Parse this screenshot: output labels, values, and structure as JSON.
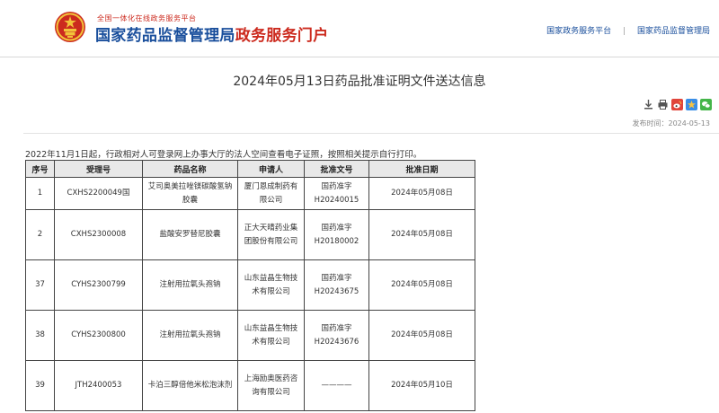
{
  "header": {
    "slogan": "全国一体化在线政务服务平台",
    "title_main": "国家药品监督管理局",
    "title_accent": "政务服务门户",
    "links": [
      {
        "label": "国家政务服务平台"
      },
      {
        "label": "国家药品监督管理局"
      }
    ],
    "link_separator": "|"
  },
  "colors": {
    "brand_blue": "#1a4f9c",
    "brand_red": "#cc2a1e",
    "emblem_gold": "#f2c23a"
  },
  "article": {
    "title": "2024年05月13日药品批准证明文件送达信息",
    "tools": [
      {
        "icon": "download-icon"
      },
      {
        "icon": "print-icon"
      },
      {
        "icon": "weibo-share-icon"
      },
      {
        "icon": "favorite-star-icon"
      },
      {
        "icon": "wechat-share-icon"
      }
    ],
    "published": "发布时间：2024-05-13",
    "notice": "2022年11月1日起，行政相对人可登录网上办事大厅的法人空间查看电子证照，按照相关提示自行打印。"
  },
  "table": {
    "headers": [
      "序号",
      "受理号",
      "药品名称",
      "申请人",
      "批准文号",
      "批准日期"
    ],
    "rows": [
      {
        "no": "1",
        "accept_no": "CXHS2200049国",
        "drug": "艾司奥美拉唑镁碳酸氢钠胶囊",
        "applicant": "厦门恩成制药有限公司",
        "approval_no": "国药准字H20240015",
        "date": "2024年05月08日"
      },
      {
        "no": "2",
        "accept_no": "CXHS2300008",
        "drug": "盐酸安罗替尼胶囊",
        "applicant": "正大天晴药业集团股份有限公司",
        "approval_no": "国药准字H20180002",
        "date": "2024年05月08日"
      },
      {
        "no": "37",
        "accept_no": "CYHS2300799",
        "drug": "注射用拉氧头孢钠",
        "applicant": "山东益晶生物技术有限公司",
        "approval_no": "国药准字H20243675",
        "date": "2024年05月08日"
      },
      {
        "no": "38",
        "accept_no": "CYHS2300800",
        "drug": "注射用拉氧头孢钠",
        "applicant": "山东益晶生物技术有限公司",
        "approval_no": "国药准字H20243676",
        "date": "2024年05月08日"
      },
      {
        "no": "39",
        "accept_no": "JTH2400053",
        "drug": "卡泊三醇倍他米松泡沫剂",
        "applicant": "上海励奥医药咨询有限公司",
        "approval_no": "————",
        "date": "2024年05月10日"
      }
    ]
  }
}
